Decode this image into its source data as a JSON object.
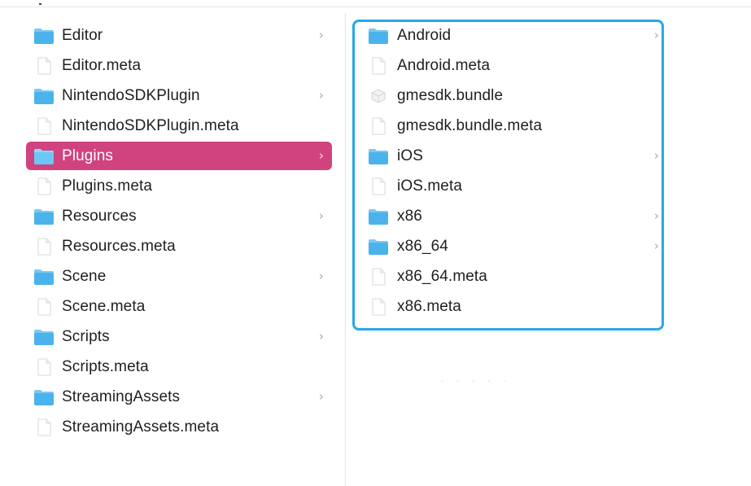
{
  "column1": {
    "items": [
      {
        "label": "Editor",
        "type": "folder",
        "selected": false
      },
      {
        "label": "Editor.meta",
        "type": "file",
        "selected": false
      },
      {
        "label": "NintendoSDKPlugin",
        "type": "folder",
        "selected": false
      },
      {
        "label": "NintendoSDKPlugin.meta",
        "type": "file",
        "selected": false
      },
      {
        "label": "Plugins",
        "type": "folder",
        "selected": true
      },
      {
        "label": "Plugins.meta",
        "type": "file",
        "selected": false
      },
      {
        "label": "Resources",
        "type": "folder",
        "selected": false
      },
      {
        "label": "Resources.meta",
        "type": "file",
        "selected": false
      },
      {
        "label": "Scene",
        "type": "folder",
        "selected": false
      },
      {
        "label": "Scene.meta",
        "type": "file",
        "selected": false
      },
      {
        "label": "Scripts",
        "type": "folder",
        "selected": false
      },
      {
        "label": "Scripts.meta",
        "type": "file",
        "selected": false
      },
      {
        "label": "StreamingAssets",
        "type": "folder",
        "selected": false
      },
      {
        "label": "StreamingAssets.meta",
        "type": "file",
        "selected": false
      }
    ]
  },
  "column2": {
    "items": [
      {
        "label": "Android",
        "type": "folder"
      },
      {
        "label": "Android.meta",
        "type": "file"
      },
      {
        "label": "gmesdk.bundle",
        "type": "bundle"
      },
      {
        "label": "gmesdk.bundle.meta",
        "type": "file"
      },
      {
        "label": "iOS",
        "type": "folder"
      },
      {
        "label": "iOS.meta",
        "type": "file"
      },
      {
        "label": "x86",
        "type": "folder"
      },
      {
        "label": "x86_64",
        "type": "folder"
      },
      {
        "label": "x86_64.meta",
        "type": "file"
      },
      {
        "label": "x86.meta",
        "type": "file"
      }
    ]
  },
  "colors": {
    "selection": "#d0437e",
    "highlight_border": "#29a8e8",
    "folder_blue": "#4bb3ec"
  },
  "icons": {
    "folder": "folder-icon",
    "file": "file-icon",
    "bundle": "bundle-icon",
    "chevron": "chevron-right-icon"
  },
  "chevron_glyph": "›"
}
